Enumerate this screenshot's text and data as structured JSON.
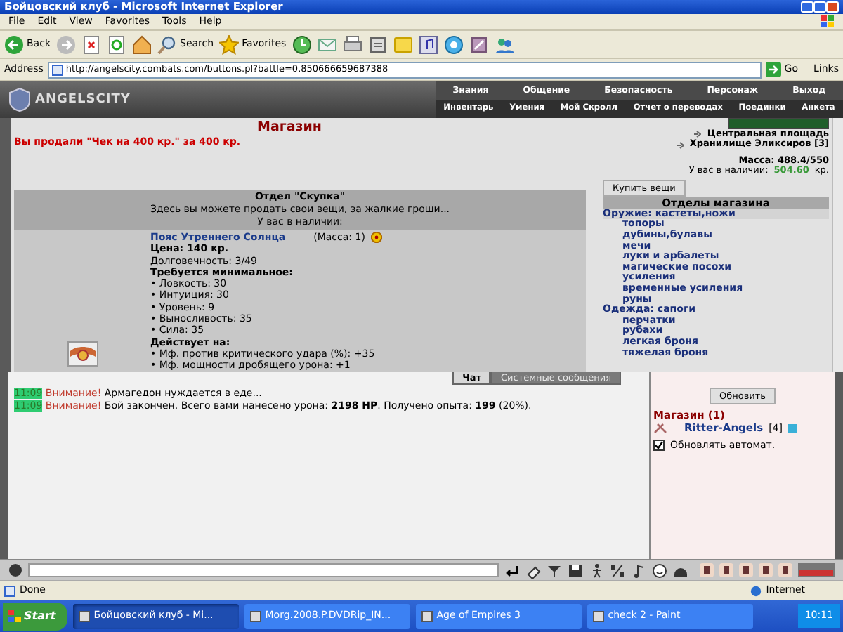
{
  "window": {
    "title": "Бойцовский клуб - Microsoft Internet Explorer"
  },
  "menu": [
    "File",
    "Edit",
    "View",
    "Favorites",
    "Tools",
    "Help"
  ],
  "toolbar": [
    {
      "kind": "back",
      "label": "Back"
    },
    {
      "kind": "forward"
    },
    {
      "kind": "stop"
    },
    {
      "kind": "refresh"
    },
    {
      "kind": "home"
    },
    {
      "kind": "search",
      "label": "Search"
    },
    {
      "kind": "favorites",
      "label": "Favorites"
    },
    {
      "kind": "history"
    },
    {
      "kind": "mail"
    },
    {
      "kind": "print"
    },
    {
      "kind": "edit"
    },
    {
      "kind": "notes"
    },
    {
      "kind": "media"
    },
    {
      "kind": "messenger"
    },
    {
      "kind": "tool"
    },
    {
      "kind": "people"
    }
  ],
  "address": {
    "label": "Address",
    "value": "http://angelscity.combats.com/buttons.pl?battle=0.850666659687388",
    "go": "Go",
    "links": "Links"
  },
  "game_nav": {
    "logo": "ANGELSCITY",
    "top": [
      "Знания",
      "Общение",
      "Безопасность",
      "Персонаж",
      "Выход"
    ],
    "bottom": [
      "Инвентарь",
      "Умения",
      "Мой Скролл",
      "Отчет о переводах",
      "Поединки",
      "Анкета"
    ]
  },
  "shop": {
    "title": "Магазин",
    "notice": "Вы продали \"Чек на 400 кр.\" за 400 кр.",
    "section": {
      "title": "Отдел \"Скупка\"",
      "subtitle": "Здесь вы можете продать свои вещи, за жалкие гроши...",
      "have": "У вас в наличии:"
    },
    "item": {
      "name": "Пояс Утреннего Солнца",
      "mass": "(Масса: 1)",
      "price": "Цена: 140 кр.",
      "durability": "Долговечность: 3/49",
      "req_title": "Требуется минимальное:",
      "requirements": [
        "• Ловкость: 30",
        "• Интуиция: 30",
        "• Уровень: 9",
        "• Выносливость: 35",
        "• Сила: 35"
      ],
      "effects_title": "Действует на:",
      "effects": [
        "• Мф. против критического удара (%): +35",
        "• Мф. мощности дробящего урона: +1"
      ]
    }
  },
  "side": {
    "links": [
      "Центральная площадь",
      "Хранилище Эликсиров [3]"
    ],
    "mass_label": "Масса:",
    "mass": "488.4/550",
    "money_label": "У вас в наличии:",
    "money": "504.60",
    "currency": "кр.",
    "buy_button": "Купить вещи",
    "departments_title": "Отделы магазина",
    "departments": [
      {
        "category": "Оружие:",
        "items": [
          "кастеты,ножи",
          "топоры",
          "дубины,булавы",
          "мечи",
          "луки и арбалеты",
          "магические посохи",
          "усиления",
          "временные усиления",
          "руны"
        ]
      },
      {
        "category": "Одежда:",
        "items": [
          "сапоги",
          "перчатки",
          "рубахи",
          "легкая броня",
          "тяжелая броня"
        ]
      }
    ]
  },
  "chat": {
    "tabs": [
      {
        "label": "Чат",
        "selected": true
      },
      {
        "label": "Системные сообщения",
        "selected": false
      }
    ],
    "messages": [
      {
        "time": "11:09",
        "warning": "Внимание!",
        "text": "Армагедон нуждается в еде..."
      },
      {
        "time": "11:09",
        "warning": "Внимание!",
        "text": "Бой закончен. Всего вами нанесено урона: **2198 HP**. Получено опыта: **199** (20%)."
      }
    ]
  },
  "online": {
    "refresh": "Обновить",
    "room": "Магазин (1)",
    "users": [
      {
        "name": "Ritter-Angels",
        "level": "[4]"
      }
    ],
    "auto_refresh": {
      "label": "Обновлять автомат.",
      "checked": true
    }
  },
  "status_bar": {
    "text": "Done",
    "zone": "Internet"
  },
  "taskbar": {
    "start": "Start",
    "tasks": [
      {
        "label": "Бойцовский клуб - Mi...",
        "selected": true
      },
      {
        "label": "Morg.2008.P.DVDRip_IN...",
        "selected": false
      },
      {
        "label": "Age of Empires 3",
        "selected": false
      },
      {
        "label": "check 2 - Paint",
        "selected": false
      }
    ],
    "clock": "10:11"
  }
}
